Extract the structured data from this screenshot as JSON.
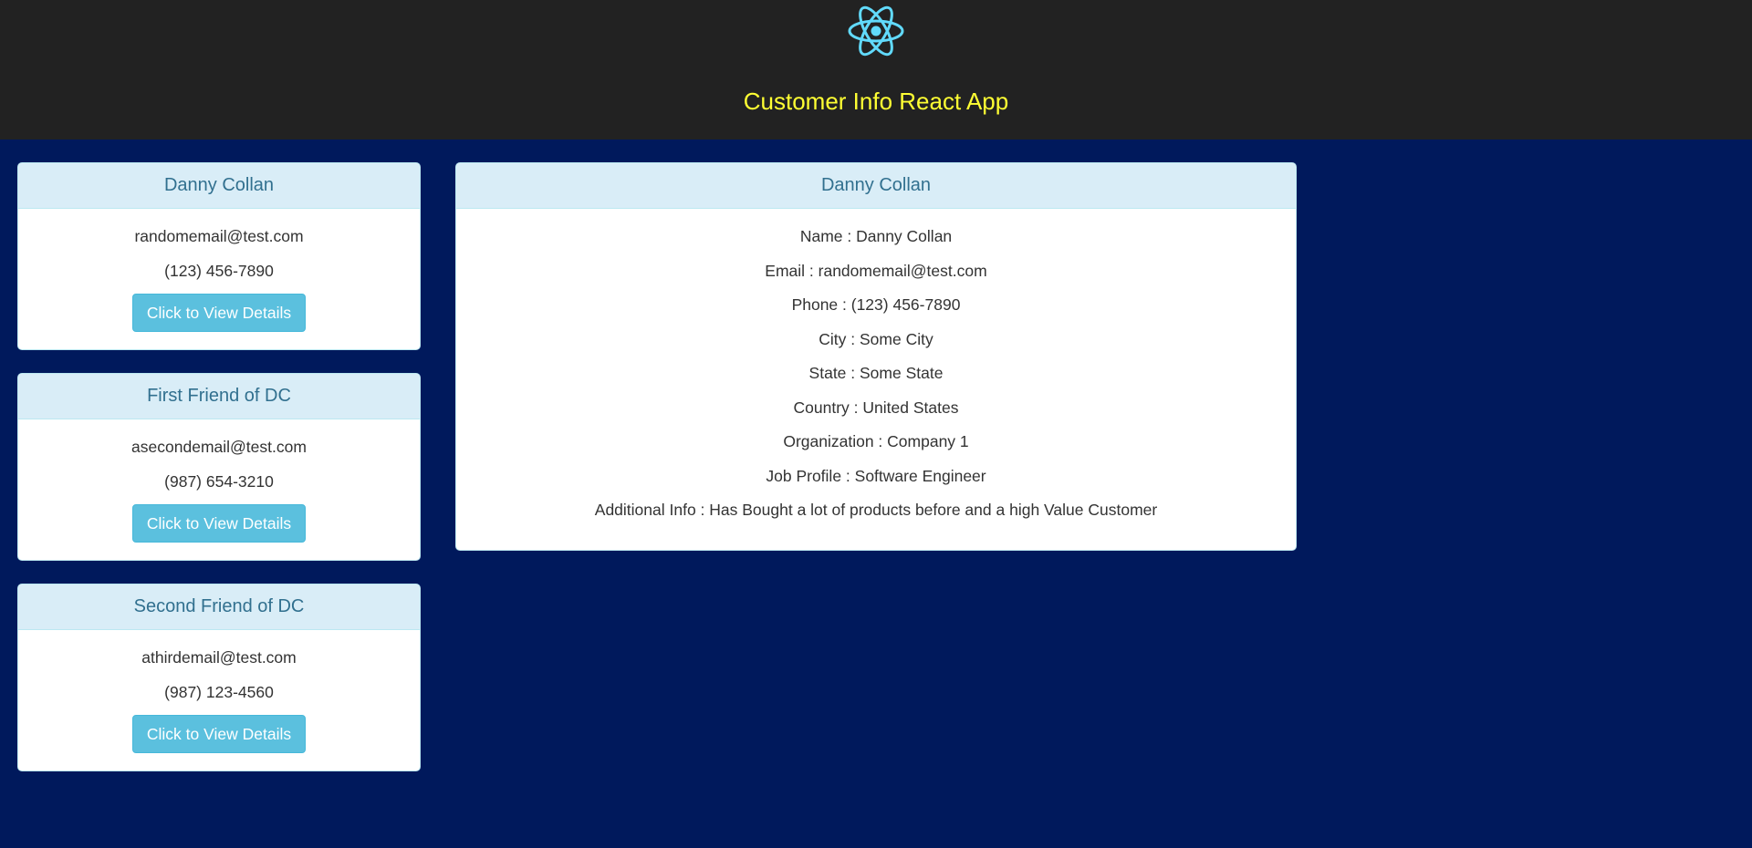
{
  "header": {
    "logo_icon": "react-atom-icon",
    "title": "Customer Info React App",
    "title_color": "#ffff33",
    "background": "#222222"
  },
  "colors": {
    "page_background": "#00195c",
    "panel_heading_bg": "#d9edf7",
    "panel_heading_text": "#31708f",
    "button_bg": "#5bc0de"
  },
  "customers": [
    {
      "name": "Danny Collan",
      "email": "randomemail@test.com",
      "phone": "(123) 456-7890",
      "button_label": "Click to View Details"
    },
    {
      "name": "First Friend of DC",
      "email": "asecondemail@test.com",
      "phone": "(987) 654-3210",
      "button_label": "Click to View Details"
    },
    {
      "name": "Second Friend of DC",
      "email": "athirdemail@test.com",
      "phone": "(987) 123-4560",
      "button_label": "Click to View Details"
    }
  ],
  "details": {
    "title": "Danny Collan",
    "lines": [
      "Name : Danny Collan",
      "Email : randomemail@test.com",
      "Phone : (123) 456-7890",
      "City : Some City",
      "State : Some State",
      "Country : United States",
      "Organization : Company 1",
      "Job Profile : Software Engineer",
      "Additional Info : Has Bought a lot of products before and a high Value Customer"
    ]
  }
}
